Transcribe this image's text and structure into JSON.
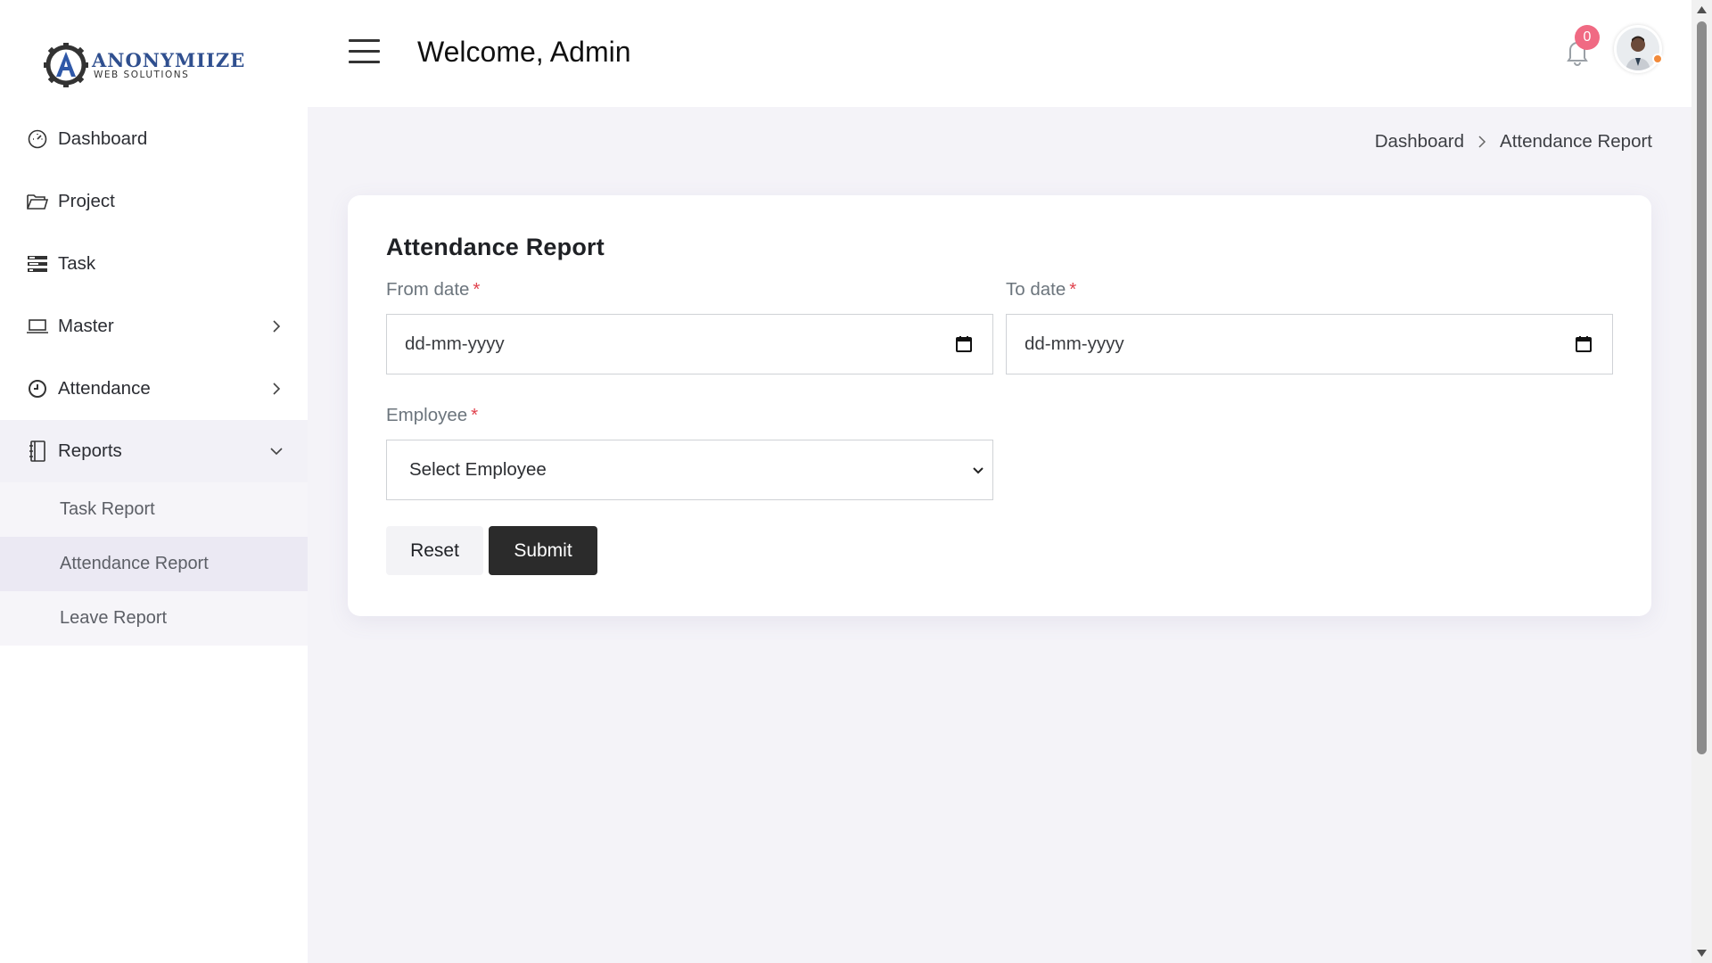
{
  "app": {
    "logo_name": "ANONYMIIZE",
    "logo_sub": "WEB SOLUTIONS"
  },
  "sidebar": {
    "items": [
      {
        "label": "Dashboard",
        "icon": "dashboard-gauge-icon"
      },
      {
        "label": "Project",
        "icon": "folder-open-icon"
      },
      {
        "label": "Task",
        "icon": "task-list-icon"
      },
      {
        "label": "Master",
        "icon": "laptop-icon",
        "expandable": true
      },
      {
        "label": "Attendance",
        "icon": "clock-icon",
        "expandable": true
      },
      {
        "label": "Reports",
        "icon": "notebook-icon",
        "expanded": true
      }
    ],
    "sub_items": [
      {
        "label": "Task Report"
      },
      {
        "label": "Attendance Report",
        "active": true
      },
      {
        "label": "Leave Report"
      }
    ]
  },
  "header": {
    "welcome": "Welcome, Admin",
    "notification_count": "0"
  },
  "breadcrumb": {
    "home": "Dashboard",
    "current": "Attendance Report"
  },
  "form": {
    "title": "Attendance Report",
    "from_label": "From date",
    "to_label": "To date",
    "required_mark": "*",
    "date_placeholder": "dd-mm-yyyy",
    "employee_label": "Employee",
    "employee_value": "Select Employee",
    "reset_label": "Reset",
    "submit_label": "Submit"
  },
  "colors": {
    "accent_dark": "#2b2b2b",
    "badge": "#f06a83",
    "required": "#e0424d",
    "content_bg": "#f4f3f8"
  }
}
